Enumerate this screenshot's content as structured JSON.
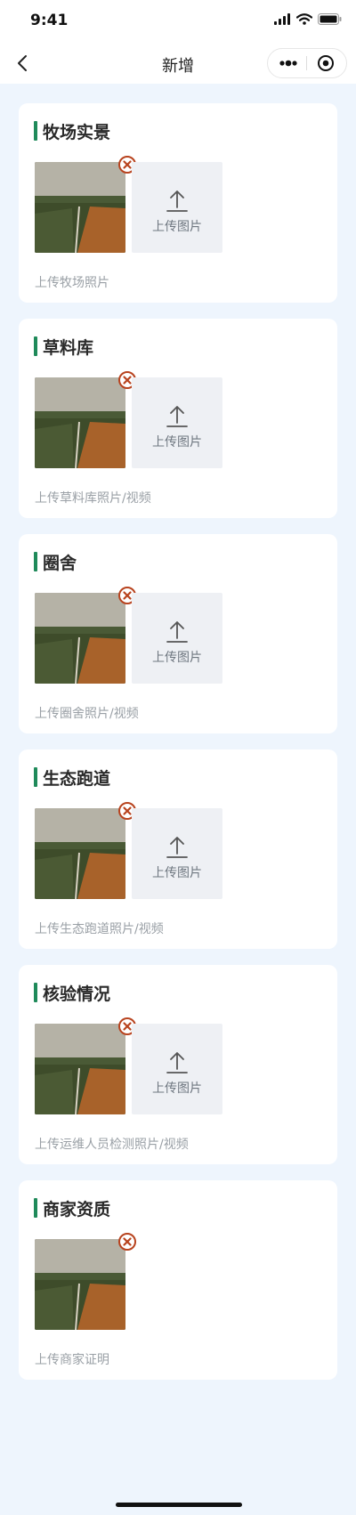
{
  "status_bar": {
    "time": "9:41"
  },
  "header": {
    "title": "新增"
  },
  "upload_label": "上传图片",
  "sections": [
    {
      "title": "牧场实景",
      "hint": "上传牧场照片"
    },
    {
      "title": "草料库",
      "hint": "上传草料库照片/视频"
    },
    {
      "title": "圈舍",
      "hint": "上传圈舍照片/视频"
    },
    {
      "title": "生态跑道",
      "hint": "上传生态跑道照片/视频"
    },
    {
      "title": "核验情况",
      "hint": "上传运维人员检测照片/视频"
    },
    {
      "title": "商家资质",
      "hint": "上传商家证明"
    }
  ],
  "colors": {
    "accent": "#1f8a5a",
    "delete": "#b8431e",
    "background": "#eef5fd"
  },
  "icons": {
    "back": "chevron-left-icon",
    "more": "more-dots-icon",
    "close": "target-circle-icon",
    "delete": "delete-circle-icon",
    "upload": "upload-arrow-icon"
  }
}
